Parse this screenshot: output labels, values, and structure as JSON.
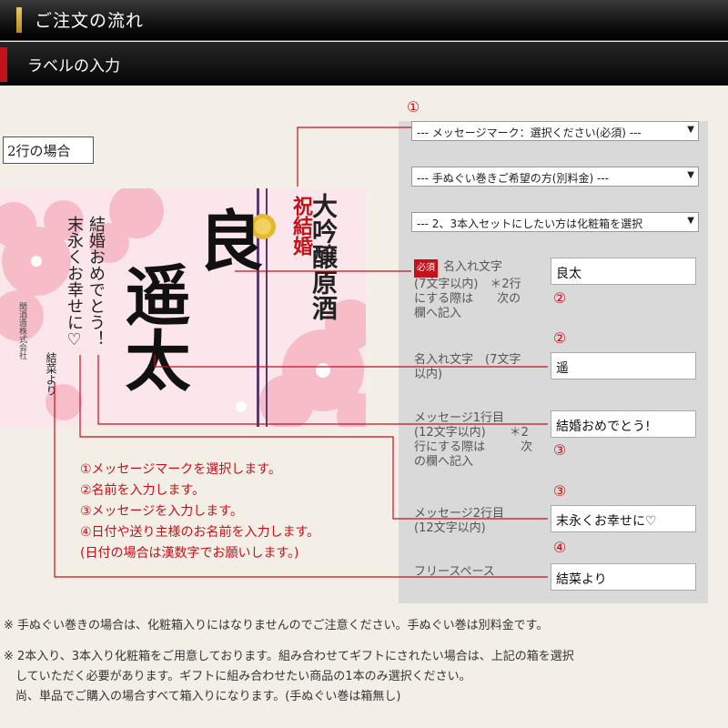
{
  "header": {
    "title": "ご注文の流れ"
  },
  "subheader": {
    "title": "ラベルの入力"
  },
  "case_label": "2行の場合",
  "label_preview": {
    "line1": "良",
    "line2": "遥太",
    "celebration": "祝結婚",
    "product": "大吟醸原酒",
    "message_line1": "結婚おめでとう！",
    "message_line2": "末永くお幸せに♡",
    "sender": "結菜より",
    "brewery": "関酒造株式会社"
  },
  "form": {
    "select1": "--- メッセージマーク：選択ください(必須) ---",
    "select2": "--- 手ぬぐい巻きご希望の方(別料金) ---",
    "select3": "--- 2、3本入セットにしたい方は化粧箱を選択",
    "required_badge": "必須",
    "name1_label_a": "名入れ文字",
    "name1_label_b": "(7文字以内)　＊2行",
    "name1_label_c": "にする際は　　次の",
    "name1_label_d": "欄へ記入",
    "name1_value": "良太",
    "name2_label_a": "名入れ文字　(7文字",
    "name2_label_b": "以内)",
    "name2_value": "遥",
    "msg1_label_a": "メッセージ1行目",
    "msg1_label_b": "(12文字以内)　　＊2",
    "msg1_label_c": "行にする際は　　　次",
    "msg1_label_d": "の欄へ記入",
    "msg1_value": "結婚おめでとう!",
    "msg2_label_a": "メッセージ2行目",
    "msg2_label_b": "(12文字以内)",
    "msg2_value": "末永くお幸せに♡",
    "free_label": "フリースペース",
    "free_value": "結菜より"
  },
  "markers": {
    "m1": "①",
    "m2": "②",
    "m3": "③",
    "m4": "④"
  },
  "steps": [
    "①メッセージマークを選択します。",
    "②名前を入力します。",
    "③メッセージを入力します。",
    "④日付や送り主様のお名前を入力します。",
    "(日付の場合は漢数字でお願いします。)"
  ],
  "notes": {
    "n1": "※ 手ぬぐい巻きの場合は、化粧箱入りにはなりませんのでご注意ください。手ぬぐい巻は別料金です。",
    "n2a": "※ 2本入り、3本入り化粧箱をご用意しております。組み合わせてギフトにされたい場合は、上記の箱を選択",
    "n2b": "　していただく必要があります。ギフトに組み合わせたい商品の1本のみ選択ください。",
    "n2c": "　尚、単品でご購入の場合すべて箱入りになります。(手ぬぐい巻は箱無し)"
  },
  "colors": {
    "accent": "#c4121a",
    "header_bg": "#111111",
    "gold": "#d4a838"
  }
}
